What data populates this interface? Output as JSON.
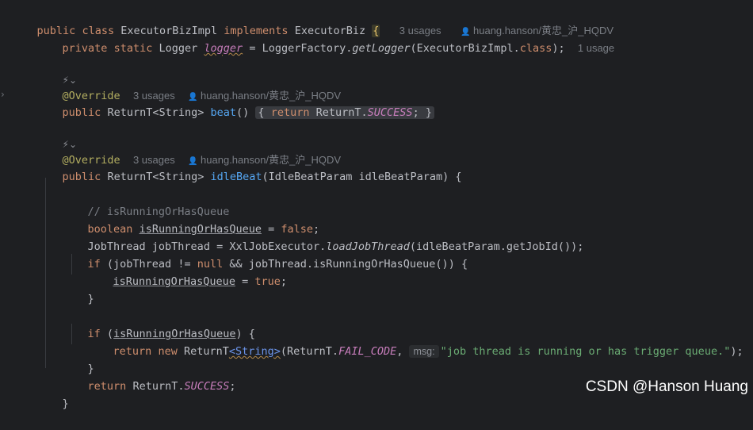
{
  "colors": {
    "background": "#1e1f22",
    "keyword": "#cf8e6d",
    "annotation": "#b3ae60",
    "method": "#56a8f5",
    "static_field": "#c77dbb",
    "string": "#6aab73",
    "comment": "#7a7e85"
  },
  "icons": {
    "fold_chevron": "›",
    "user": "👤",
    "ai_assist": "⚡⌄"
  },
  "hints": {
    "class_usages": "3 usages",
    "class_author": "huang.hanson/黄忠_沪_HQDV",
    "logger_usages": "1 usage",
    "beat_usages": "3 usages",
    "beat_author": "huang.hanson/黄忠_沪_HQDV",
    "idle_usages": "3 usages",
    "idle_author": "huang.hanson/黄忠_沪_HQDV",
    "msg_param": "msg:"
  },
  "code": {
    "kw_public": "public",
    "kw_class": "class",
    "class_name": "ExecutorBizImpl",
    "kw_implements": "implements",
    "iface": "ExecutorBiz",
    "brace_open": "{",
    "kw_private": "private",
    "kw_static": "static",
    "logger_type": "Logger",
    "logger_var": "logger",
    "eq": " = ",
    "logger_factory": "LoggerFactory.",
    "get_logger": "getLogger",
    "logger_arg": "(ExecutorBizImpl.",
    "kw_class2": "class",
    "logger_end": ");",
    "override": "@Override",
    "ret_type": "ReturnT<String>",
    "beat_name": "beat",
    "beat_parens": "()",
    "collapsed_open": "{",
    "kw_return": "return",
    "returnt_dot": "ReturnT.",
    "success": "SUCCESS",
    "collapsed_end": ";",
    "collapsed_close": "}",
    "idle_name": "idleBeat",
    "idle_params": "(IdleBeatParam idleBeatParam) {",
    "comment": "// isRunningOrHasQueue",
    "kw_boolean": "boolean",
    "var_running": "isRunningOrHasQueue",
    "kw_false": "false",
    "semicolon": ";",
    "jobthread_decl": "JobThread jobThread = XxlJobExecutor.",
    "load_job_thread": "loadJobThread",
    "load_args": "(idleBeatParam.getJobId());",
    "kw_if": "if",
    "if_cond_open": " (jobThread != ",
    "kw_null": "null",
    "if_cond_rest": " && jobThread.isRunningOrHasQueue()) {",
    "assign_eq": " = ",
    "kw_true": "true",
    "close_brace": "}",
    "if2_open": " (",
    "if2_close": ") {",
    "kw_new": "new",
    "returnt_word": "ReturnT",
    "generic_string": "<String>",
    "fail_open": "(ReturnT.",
    "fail_code": "FAIL_CODE",
    "comma": ", ",
    "msg_string": "\"job thread is running or has trigger queue.\"",
    "fail_close": ");",
    "kw_return2": "return",
    "returnt_dot2": "ReturnT.",
    "success2": "SUCCESS",
    "end_semicolon": ";",
    "method_close": "}"
  },
  "watermark": "CSDN @Hanson Huang"
}
